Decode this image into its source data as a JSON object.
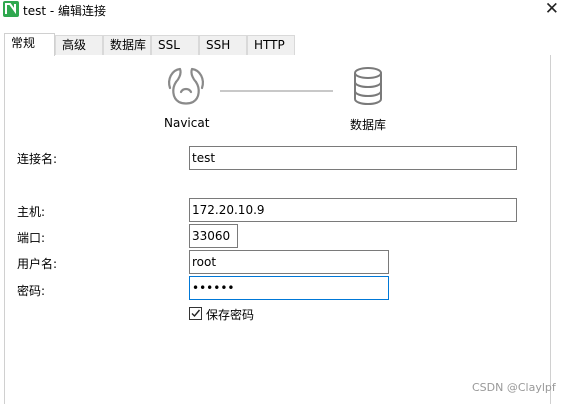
{
  "window": {
    "title": "test - 编辑连接"
  },
  "tabs": [
    {
      "label": "常规",
      "active": true
    },
    {
      "label": "高级",
      "active": false
    },
    {
      "label": "数据库",
      "active": false
    },
    {
      "label": "SSL",
      "active": false
    },
    {
      "label": "SSH",
      "active": false
    },
    {
      "label": "HTTP",
      "active": false
    }
  ],
  "diagram": {
    "left_label": "Navicat",
    "right_label": "数据库",
    "left_icon": "navicat-icon",
    "right_icon": "database-icon"
  },
  "form": {
    "connection_name": {
      "label": "连接名:",
      "value": "test"
    },
    "host": {
      "label": "主机:",
      "value": "172.20.10.9"
    },
    "port": {
      "label": "端口:",
      "value": "33060"
    },
    "username": {
      "label": "用户名:",
      "value": "root"
    },
    "password": {
      "label": "密码:",
      "value": "••••••"
    },
    "save_password": {
      "label": "保存密码",
      "checked": true
    }
  },
  "watermark": "CSDN @Claylpf"
}
